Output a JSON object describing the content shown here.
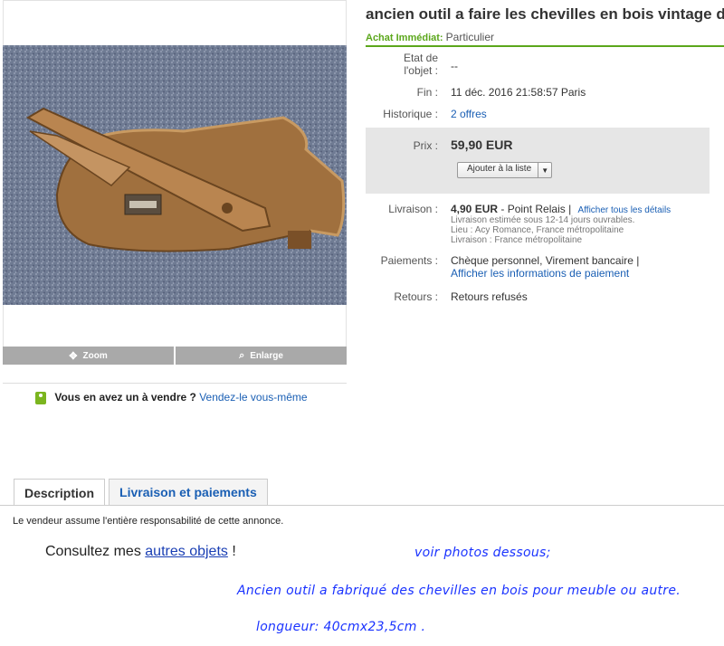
{
  "item": {
    "title": "ancien outil a faire les chevilles en bois vintage d",
    "buy_type_label": "Achat Immédiat:",
    "buy_type_value": "Particulier"
  },
  "image_panel": {
    "zoom_label": "Zoom",
    "enlarge_label": "Enlarge"
  },
  "sell_prompt": {
    "question": "Vous en avez un à vendre ?",
    "link": "Vendez-le vous-même"
  },
  "details": {
    "condition_label_1": "Etat de",
    "condition_label_2": "l'objet :",
    "condition_value": "--",
    "end_label": "Fin :",
    "end_value": "11 déc. 2016 21:58:57 Paris",
    "history_label": "Historique :",
    "history_value": "2 offres",
    "price_label": "Prix :",
    "price_value": "59,90 EUR",
    "watch_button": "Ajouter à la liste",
    "watch_arrow": "▼",
    "delivery_label": "Livraison :",
    "delivery_price": "4,90 EUR",
    "delivery_method": "- Point Relais |",
    "delivery_details_link": "Afficher tous les détails",
    "delivery_estimate": "Livraison estimée sous 12-14 jours ouvrables.",
    "delivery_location": "Lieu : Acy Romance, France métropolitaine",
    "delivery_dest": "Livraison : France métropolitaine",
    "payment_label": "Paiements :",
    "payment_value": "Chèque personnel, Virement bancaire |",
    "payment_link": "Afficher les informations de paiement",
    "returns_label": "Retours :",
    "returns_value": "Retours refusés"
  },
  "tabs": {
    "description": "Description",
    "shipping": "Livraison et paiements"
  },
  "description": {
    "responsibility": "Le vendeur assume l'entière responsabilité de cette annonce.",
    "consult_prefix": "Consultez mes",
    "consult_link": "autres objets",
    "consult_suffix": "!",
    "line_photos": "voir photos dessous;",
    "line_tool": "Ancien outil a fabriqué des chevilles en bois pour meuble ou autre.",
    "line_size": "longueur: 40cmx23,5cm ."
  },
  "colors": {
    "green_accent": "#5ba71b",
    "link_blue": "#1a5fb4",
    "comic_blue": "#1a33ff"
  }
}
